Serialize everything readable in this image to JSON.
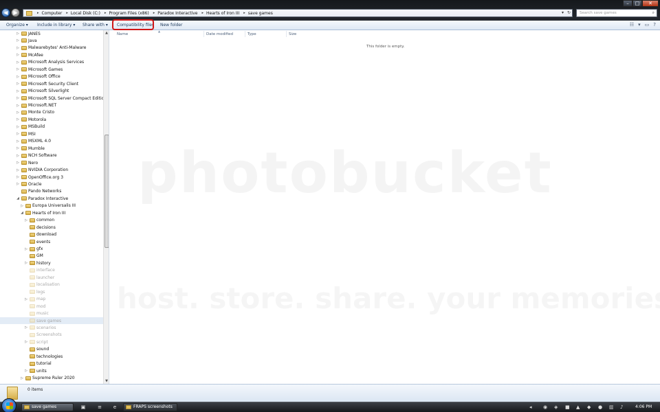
{
  "address_bar": {
    "crumbs": [
      "Computer",
      "Local Disk (C:)",
      "Program Files (x86)",
      "Paradox Interactive",
      "Hearts of Iron III",
      "save games"
    ],
    "search_placeholder": "Search save games"
  },
  "command_bar": {
    "organize": "Organize ▾",
    "include_in_library": "Include in library ▾",
    "share_with": "Share with ▾",
    "compatibility_files": "Compatibility files",
    "new_folder": "New folder"
  },
  "columns": {
    "name": "Name",
    "date_modified": "Date modified",
    "type": "Type",
    "size": "Size"
  },
  "empty_message": "This folder is empty.",
  "nav_tree": [
    {
      "label": "JANES",
      "expander": "▷",
      "level": 1,
      "faded": false
    },
    {
      "label": "Java",
      "expander": "▷",
      "level": 1,
      "faded": false
    },
    {
      "label": "Malwarebytes' Anti-Malware",
      "expander": "▷",
      "level": 1,
      "faded": false
    },
    {
      "label": "McAfee",
      "expander": "▷",
      "level": 1,
      "faded": false
    },
    {
      "label": "Microsoft Analysis Services",
      "expander": "▷",
      "level": 1,
      "faded": false
    },
    {
      "label": "Microsoft Games",
      "expander": "▷",
      "level": 1,
      "faded": false
    },
    {
      "label": "Microsoft Office",
      "expander": "▷",
      "level": 1,
      "faded": false
    },
    {
      "label": "Microsoft Security Client",
      "expander": "▷",
      "level": 1,
      "faded": false
    },
    {
      "label": "Microsoft Silverlight",
      "expander": "▷",
      "level": 1,
      "faded": false
    },
    {
      "label": "Microsoft SQL Server Compact Edition",
      "expander": "▷",
      "level": 1,
      "faded": false
    },
    {
      "label": "Microsoft.NET",
      "expander": "▷",
      "level": 1,
      "faded": false
    },
    {
      "label": "Monte Cristo",
      "expander": "▷",
      "level": 1,
      "faded": false
    },
    {
      "label": "Motorola",
      "expander": "▷",
      "level": 1,
      "faded": false
    },
    {
      "label": "MSBuild",
      "expander": "▷",
      "level": 1,
      "faded": false
    },
    {
      "label": "MSI",
      "expander": "▷",
      "level": 1,
      "faded": false
    },
    {
      "label": "MSXML 4.0",
      "expander": "▷",
      "level": 1,
      "faded": false
    },
    {
      "label": "Mumble",
      "expander": "▷",
      "level": 1,
      "faded": false
    },
    {
      "label": "NCH Software",
      "expander": "▷",
      "level": 1,
      "faded": false
    },
    {
      "label": "Nero",
      "expander": "▷",
      "level": 1,
      "faded": false
    },
    {
      "label": "NVIDIA Corporation",
      "expander": "▷",
      "level": 1,
      "faded": false
    },
    {
      "label": "OpenOffice.org 3",
      "expander": "▷",
      "level": 1,
      "faded": false
    },
    {
      "label": "Oracle",
      "expander": "▷",
      "level": 1,
      "faded": false
    },
    {
      "label": "Pando Networks",
      "expander": "",
      "level": 1,
      "faded": false
    },
    {
      "label": "Paradox Interactive",
      "expander": "◢",
      "level": 1,
      "faded": false
    },
    {
      "label": "Europa Universalis III",
      "expander": "▷",
      "level": 2,
      "faded": false
    },
    {
      "label": "Hearts of Iron III",
      "expander": "◢",
      "level": 2,
      "faded": false
    },
    {
      "label": "common",
      "expander": "▷",
      "level": 3,
      "faded": false
    },
    {
      "label": "decisions",
      "expander": "",
      "level": 3,
      "faded": false
    },
    {
      "label": "download",
      "expander": "",
      "level": 3,
      "faded": false
    },
    {
      "label": "events",
      "expander": "",
      "level": 3,
      "faded": false
    },
    {
      "label": "gfx",
      "expander": "▷",
      "level": 3,
      "faded": false
    },
    {
      "label": "GM",
      "expander": "",
      "level": 3,
      "faded": false
    },
    {
      "label": "history",
      "expander": "▷",
      "level": 3,
      "faded": false
    },
    {
      "label": "interface",
      "expander": "",
      "level": 3,
      "faded": true
    },
    {
      "label": "launcher",
      "expander": "",
      "level": 3,
      "faded": true
    },
    {
      "label": "localisation",
      "expander": "",
      "level": 3,
      "faded": true
    },
    {
      "label": "logs",
      "expander": "",
      "level": 3,
      "faded": true
    },
    {
      "label": "map",
      "expander": "▷",
      "level": 3,
      "faded": true
    },
    {
      "label": "mod",
      "expander": "",
      "level": 3,
      "faded": true
    },
    {
      "label": "music",
      "expander": "",
      "level": 3,
      "faded": true
    },
    {
      "label": "save games",
      "expander": "",
      "level": 3,
      "faded": true,
      "selected": true
    },
    {
      "label": "scenarios",
      "expander": "▷",
      "level": 3,
      "faded": true
    },
    {
      "label": "Screenshots",
      "expander": "",
      "level": 3,
      "faded": true
    },
    {
      "label": "script",
      "expander": "▷",
      "level": 3,
      "faded": true
    },
    {
      "label": "sound",
      "expander": "",
      "level": 3,
      "faded": false
    },
    {
      "label": "technologies",
      "expander": "",
      "level": 3,
      "faded": false
    },
    {
      "label": "tutorial",
      "expander": "",
      "level": 3,
      "faded": false
    },
    {
      "label": "units",
      "expander": "▷",
      "level": 3,
      "faded": false
    },
    {
      "label": "Supreme Ruler 2020",
      "expander": "▷",
      "level": 2,
      "faded": false
    }
  ],
  "details_pane": {
    "item_count": "0 items"
  },
  "taskbar": {
    "tasks": [
      "save games",
      "FRAPS screenshots"
    ],
    "clock": "4:06 PM"
  },
  "colors": {
    "highlight_ring": "#d01515",
    "selection": "#e3ecf6",
    "folder": "#e8c766"
  },
  "watermark": {
    "line1": "photobucket",
    "line2": "host. store. share. your memories online."
  }
}
